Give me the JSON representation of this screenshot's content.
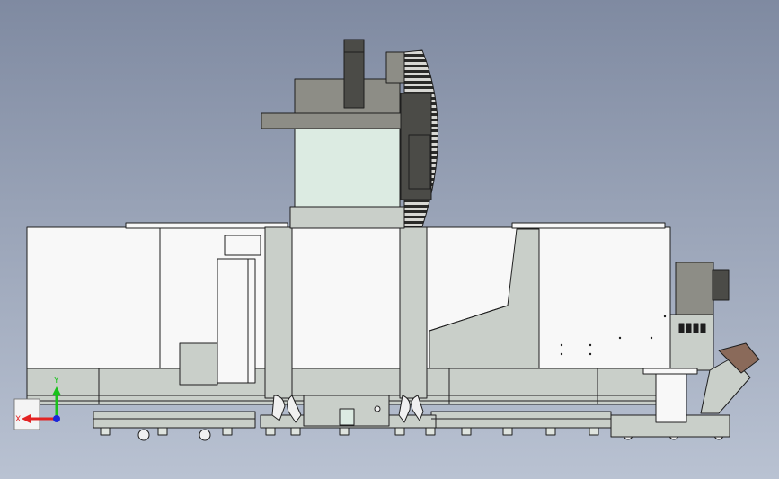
{
  "view": {
    "background_top": "#7f8aa1",
    "background_bottom": "#b9c2d2",
    "body_color": "#f8f8f8",
    "base_color": "#c9cfc9",
    "glass_color": "#dcebe2",
    "head_color": "#8d8d86",
    "dark_color": "#4b4b47",
    "outline_color": "#1e1e1e"
  },
  "axes": {
    "y_label": "Y",
    "x_label": "X",
    "y_color": "#18c21b",
    "x_color": "#e32323",
    "z_color": "#1b27d9"
  }
}
